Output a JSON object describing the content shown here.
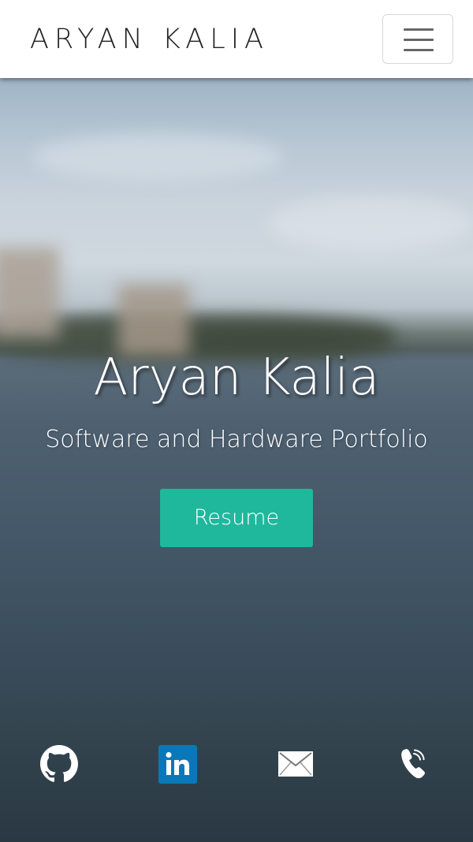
{
  "navbar": {
    "brand": "ARYAN KALIA",
    "menu_icon": "hamburger-menu-icon"
  },
  "hero": {
    "title": "Aryan Kalia",
    "subtitle": "Software and Hardware Portfolio",
    "resume_label": "Resume",
    "accent_color": "#1fb89c"
  },
  "social": [
    {
      "icon": "github-icon"
    },
    {
      "icon": "linkedin-icon"
    },
    {
      "icon": "email-icon"
    },
    {
      "icon": "phone-icon"
    }
  ]
}
